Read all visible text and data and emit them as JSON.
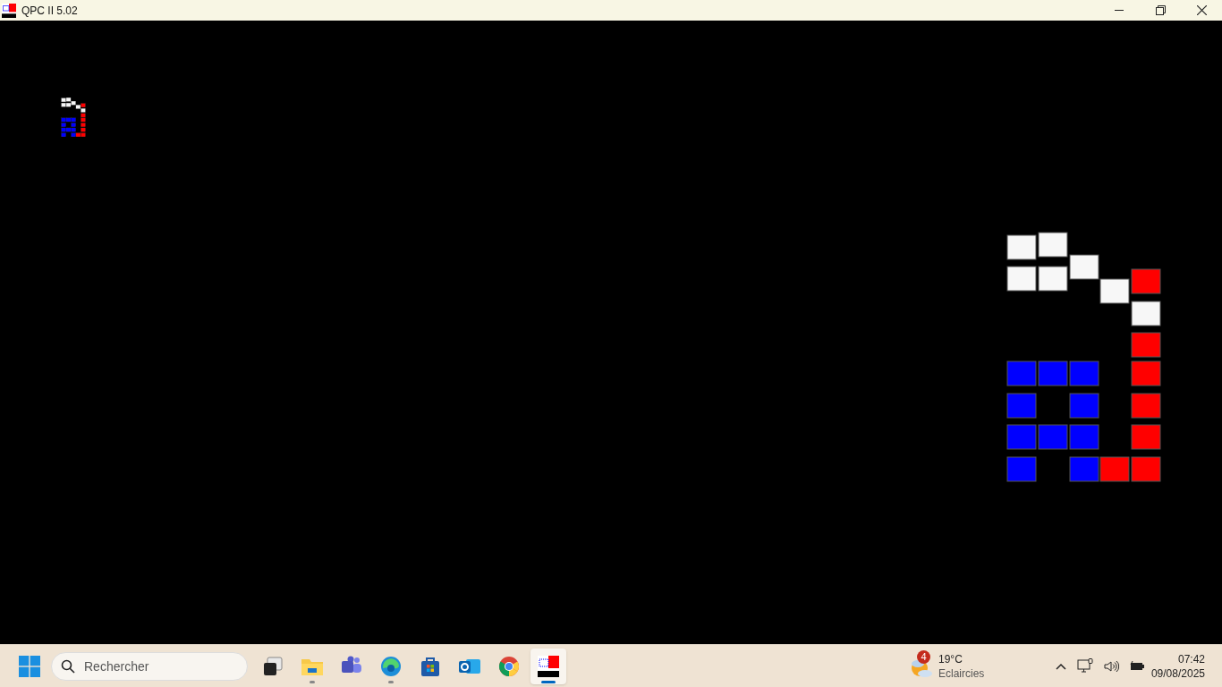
{
  "window": {
    "title": "QPC II 5.02"
  },
  "taskbar": {
    "search": {
      "placeholder": "Rechercher"
    },
    "apps": [
      {
        "kind": "taskview",
        "running": false,
        "selected": false
      },
      {
        "kind": "explorer",
        "running": true,
        "selected": false
      },
      {
        "kind": "teams",
        "running": false,
        "selected": false
      },
      {
        "kind": "edge",
        "running": true,
        "selected": false
      },
      {
        "kind": "store",
        "running": false,
        "selected": false
      },
      {
        "kind": "outlook",
        "running": false,
        "selected": false
      },
      {
        "kind": "chrome",
        "running": false,
        "selected": false
      },
      {
        "kind": "qpc",
        "running": true,
        "selected": true
      }
    ],
    "weather": {
      "badge": "4",
      "temperature": "19°C",
      "condition": "Eclaircies"
    },
    "clock": {
      "time": "07:42",
      "date": "09/08/2025"
    }
  }
}
